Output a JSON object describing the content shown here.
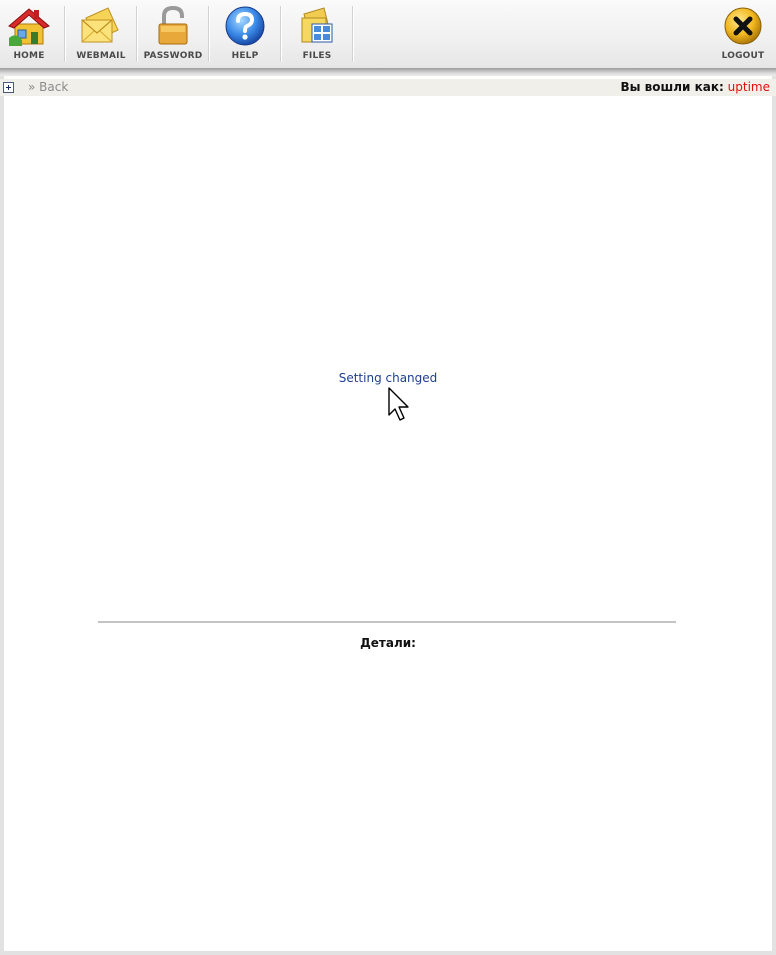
{
  "toolbar": {
    "items": [
      {
        "label": "HOME",
        "icon": "home-icon"
      },
      {
        "label": "WEBMAIL",
        "icon": "envelope-icon"
      },
      {
        "label": "PASSWORD",
        "icon": "padlock-icon"
      },
      {
        "label": "HELP",
        "icon": "help-icon"
      },
      {
        "label": "FILES",
        "icon": "files-icon"
      }
    ],
    "logout": {
      "label": "LOGOUT",
      "icon": "logout-icon"
    }
  },
  "subbar": {
    "back_label": "» Back",
    "logged_in_label": "Вы вошли как:",
    "username": "uptime"
  },
  "main": {
    "message": "Setting changed",
    "details_label": "Детали:"
  },
  "colors": {
    "message": "#1f3f8f",
    "username": "#e01010",
    "subbar_bg": "#f1efea"
  }
}
